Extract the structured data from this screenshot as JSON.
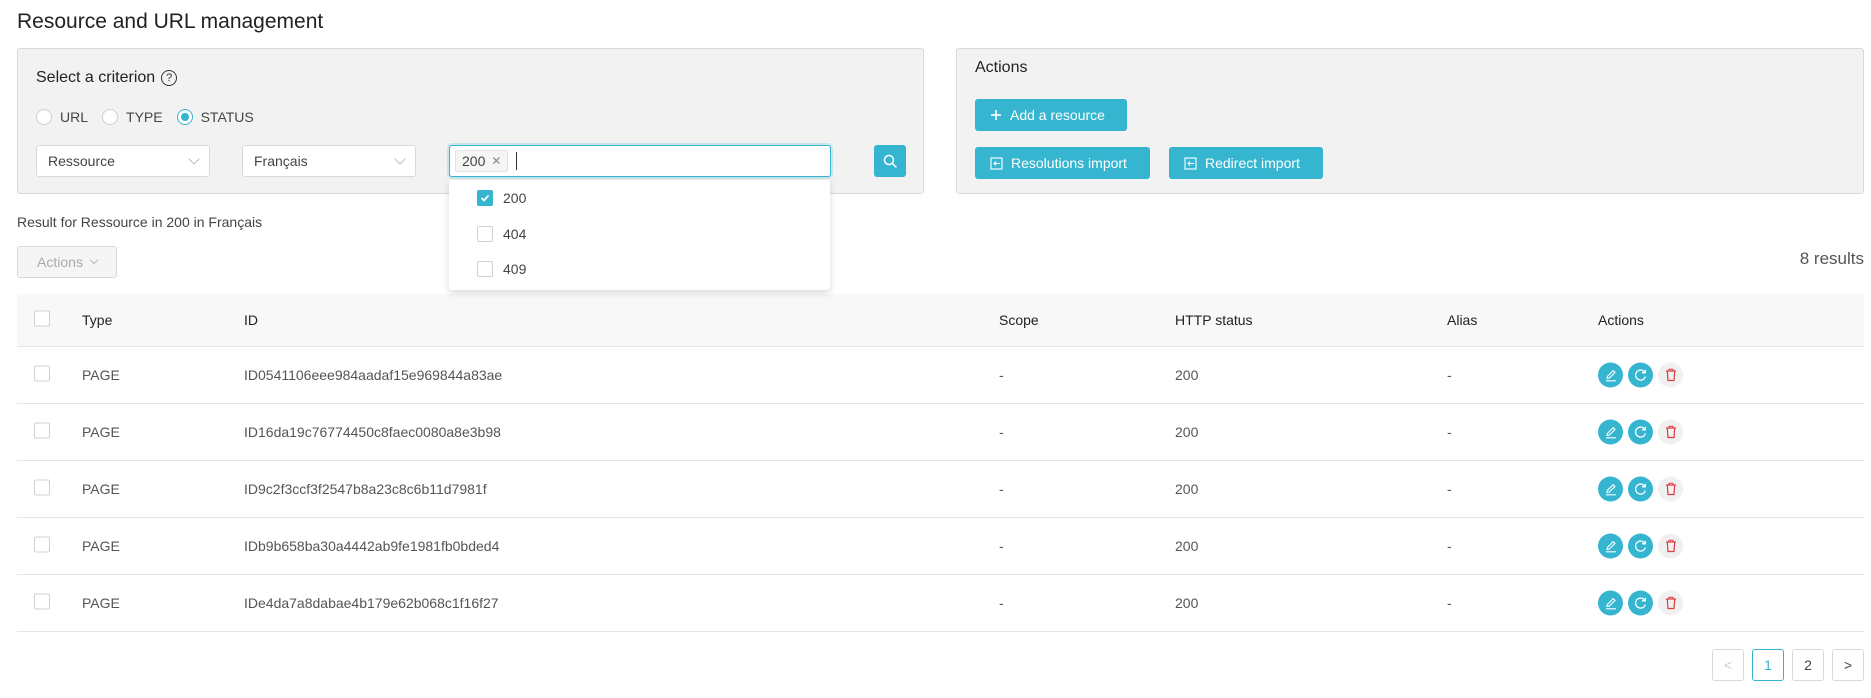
{
  "page": {
    "title": "Resource and URL management"
  },
  "colors": {
    "accent": "#35b5cf",
    "danger": "#e0393e"
  },
  "criteria": {
    "title": "Select a criterion",
    "help_icon": "question-circle-icon",
    "radios": [
      {
        "label": "URL",
        "checked": false
      },
      {
        "label": "TYPE",
        "checked": false
      },
      {
        "label": "STATUS",
        "checked": true
      }
    ],
    "resource_select": {
      "value": "Ressource"
    },
    "language_select": {
      "value": "Français"
    },
    "status_select": {
      "tags": [
        "200"
      ],
      "options": [
        {
          "label": "200",
          "checked": true
        },
        {
          "label": "404",
          "checked": false
        },
        {
          "label": "409",
          "checked": false
        }
      ]
    },
    "search_icon": "search-icon"
  },
  "actions_panel": {
    "title": "Actions",
    "add_label": "Add a resource",
    "resolutions_import_label": "Resolutions import",
    "redirect_import_label": "Redirect import"
  },
  "results": {
    "summary": "Result for Ressource in 200 in Français",
    "bulk_actions_label": "Actions",
    "count_label": "8 results"
  },
  "table": {
    "columns": [
      "Type",
      "ID",
      "Scope",
      "HTTP status",
      "Alias",
      "Actions"
    ],
    "rows": [
      {
        "type": "PAGE",
        "id": "ID0541106eee984aadaf15e969844a83ae",
        "scope": "-",
        "status": "200",
        "alias": "-"
      },
      {
        "type": "PAGE",
        "id": "ID16da19c76774450c8faec0080a8e3b98",
        "scope": "-",
        "status": "200",
        "alias": "-"
      },
      {
        "type": "PAGE",
        "id": "ID9c2f3ccf3f2547b8a23c8c6b11d7981f",
        "scope": "-",
        "status": "200",
        "alias": "-"
      },
      {
        "type": "PAGE",
        "id": "IDb9b658ba30a4442ab9fe1981fb0bded4",
        "scope": "-",
        "status": "200",
        "alias": "-"
      },
      {
        "type": "PAGE",
        "id": "IDe4da7a8dabae4b179e62b068c1f16f27",
        "scope": "-",
        "status": "200",
        "alias": "-"
      }
    ]
  },
  "pagination": {
    "prev": "<",
    "pages": [
      "1",
      "2"
    ],
    "current": "1",
    "next": ">"
  }
}
